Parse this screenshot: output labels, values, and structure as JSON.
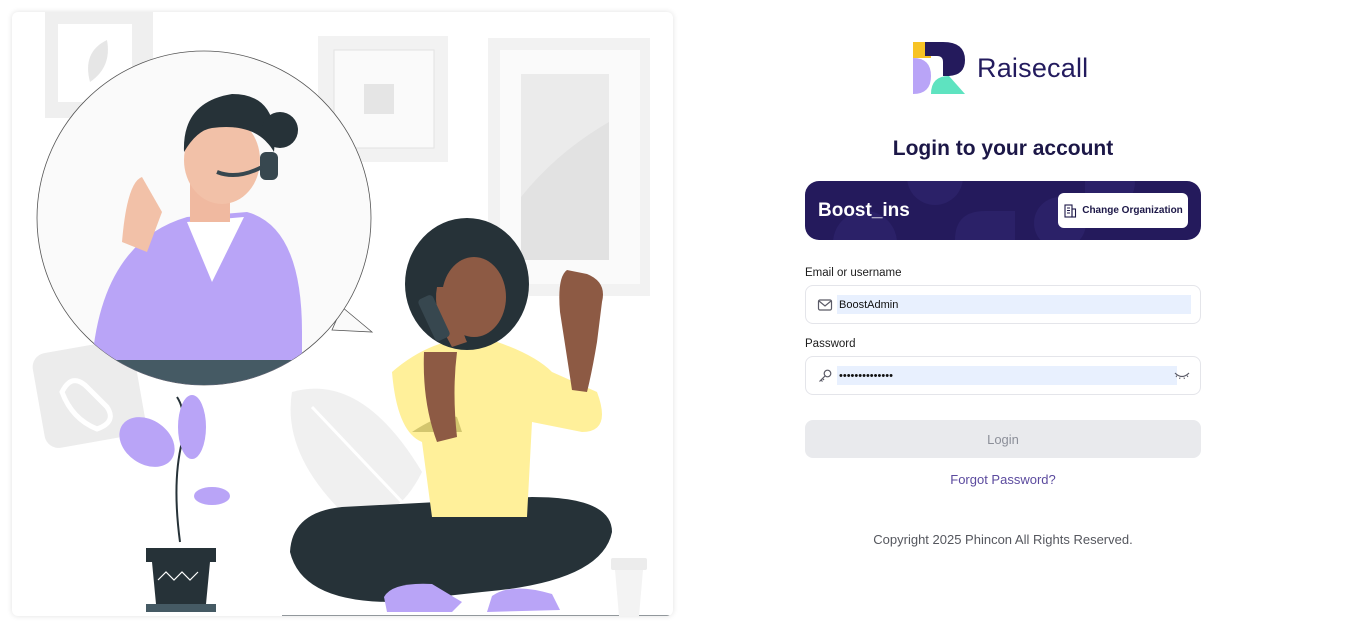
{
  "brand": {
    "name": "Raisecall",
    "logo_icon": "raisecall-logo-icon"
  },
  "login": {
    "title": "Login to your account",
    "organization": {
      "name": "Boost_ins",
      "change_label": "Change Organization",
      "icon": "building-icon"
    },
    "email": {
      "label": "Email or username",
      "value": "BoostAdmin",
      "icon": "mail-icon"
    },
    "password": {
      "label": "Password",
      "value": "••••••••••••••",
      "icon": "key-icon",
      "toggle_icon": "eye-closed-icon"
    },
    "submit_label": "Login",
    "forgot_label": "Forgot Password?",
    "copyright": "Copyright 2025 Phincon All Rights Reserved."
  },
  "colors": {
    "brand_dark": "#241a5c",
    "purple": "#b9a4f7",
    "mint": "#5ee3c0",
    "yellow": "#f7c325",
    "disabled_button": "#e9eaed",
    "link": "#5b4a9e"
  }
}
